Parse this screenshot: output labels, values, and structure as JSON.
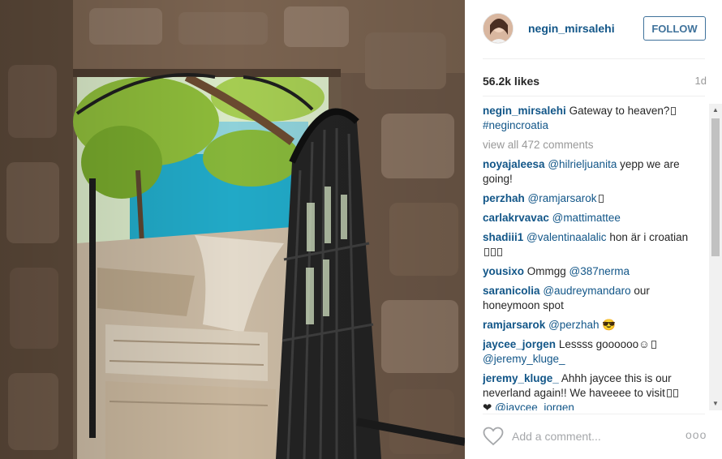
{
  "post": {
    "author": "negin_mirsalehi",
    "follow_label": "FOLLOW",
    "likes": "56.2k likes",
    "age": "1d",
    "caption": {
      "user": "negin_mirsalehi",
      "text": "Gateway to heaven?",
      "hashtag": "#negincroatia"
    },
    "view_all": "view all 472 comments"
  },
  "comments": [
    {
      "user": "noyajaleesa",
      "mention": "@hilrieljuanita",
      "text": " yepp we are going!"
    },
    {
      "user": "perzhah",
      "mention": "@ramjarsarok",
      "text": ""
    },
    {
      "user": "carlakrvavac",
      "mention": "@mattimattee",
      "text": ""
    },
    {
      "user": "shadiii1",
      "mention": "@valentinaalalic",
      "text": " hon är i croatian"
    },
    {
      "user": "yousixo",
      "text": "Ommgg ",
      "mention": "@387nerma"
    },
    {
      "user": "saranicolia",
      "mention": "@audreymandaro",
      "text": " our honeymoon spot"
    },
    {
      "user": "ramjarsarok",
      "mention": "@perzhah",
      "text": " 😎"
    },
    {
      "user": "jaycee_jorgen",
      "text": "Lessss goooooo☺",
      "mention": "@jeremy_kluge_"
    },
    {
      "user": "jeremy_kluge_",
      "text": "Ahhh jaycee this is our neverland again!! We haveeee to visit",
      "mention": "@jaycee_jorgen"
    }
  ],
  "footer": {
    "add_comment_placeholder": "Add a comment...",
    "more_label": "ooo"
  },
  "icons": {
    "like": "heart-outline-icon",
    "more": "more-options-icon",
    "scroll_up": "scroll-up-arrow-icon",
    "scroll_down": "scroll-down-arrow-icon"
  },
  "colors": {
    "link": "#125688",
    "follow": "#3f729b",
    "muted": "#999999"
  }
}
